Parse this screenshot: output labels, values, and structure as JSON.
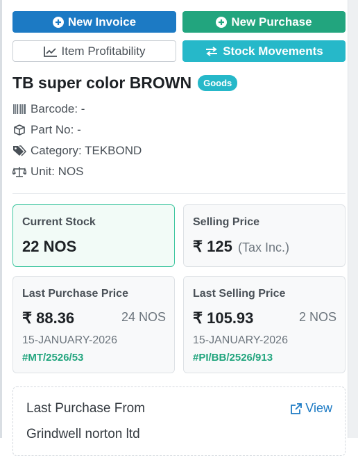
{
  "actions": {
    "new_invoice": "New Invoice",
    "new_purchase": "New Purchase",
    "item_profitability": "Item Profitability",
    "stock_movements": "Stock Movements"
  },
  "item": {
    "name": "TB super color BROWN",
    "type_badge": "Goods",
    "barcode": "Barcode: -",
    "part_no": "Part No: -",
    "category": "Category: TEKBOND",
    "unit": "Unit: NOS"
  },
  "cards": {
    "current_stock": {
      "label": "Current Stock",
      "value": "22 NOS"
    },
    "selling_price": {
      "label": "Selling Price",
      "value": "₹ 125",
      "note": "(Tax Inc.)"
    },
    "last_purchase": {
      "label": "Last Purchase Price",
      "value": "₹ 88.36",
      "qty": "24 NOS",
      "date": "15-JANUARY-2026",
      "ref": "#MT/2526/53"
    },
    "last_selling": {
      "label": "Last Selling Price",
      "value": "₹ 105.93",
      "qty": "2 NOS",
      "date": "15-JANUARY-2026",
      "ref": "#PI/BB/2526/913"
    }
  },
  "last_purchase_from": {
    "heading": "Last Purchase From",
    "view_label": "View",
    "vendor": "Grindwell norton ltd"
  },
  "icons": {
    "new_invoice": "plus-circle-icon",
    "new_purchase": "plus-circle-icon",
    "item_profitability": "line-chart-icon",
    "stock_movements": "exchange-arrows-icon",
    "barcode": "barcode-icon",
    "part_no": "box-icon",
    "category": "tags-icon",
    "unit": "balance-scale-icon",
    "view": "external-link-icon"
  },
  "colors": {
    "primary": "#1c7ac4",
    "success": "#22a57e",
    "info": "#26b8c9",
    "active_border": "#3fc6a0"
  }
}
